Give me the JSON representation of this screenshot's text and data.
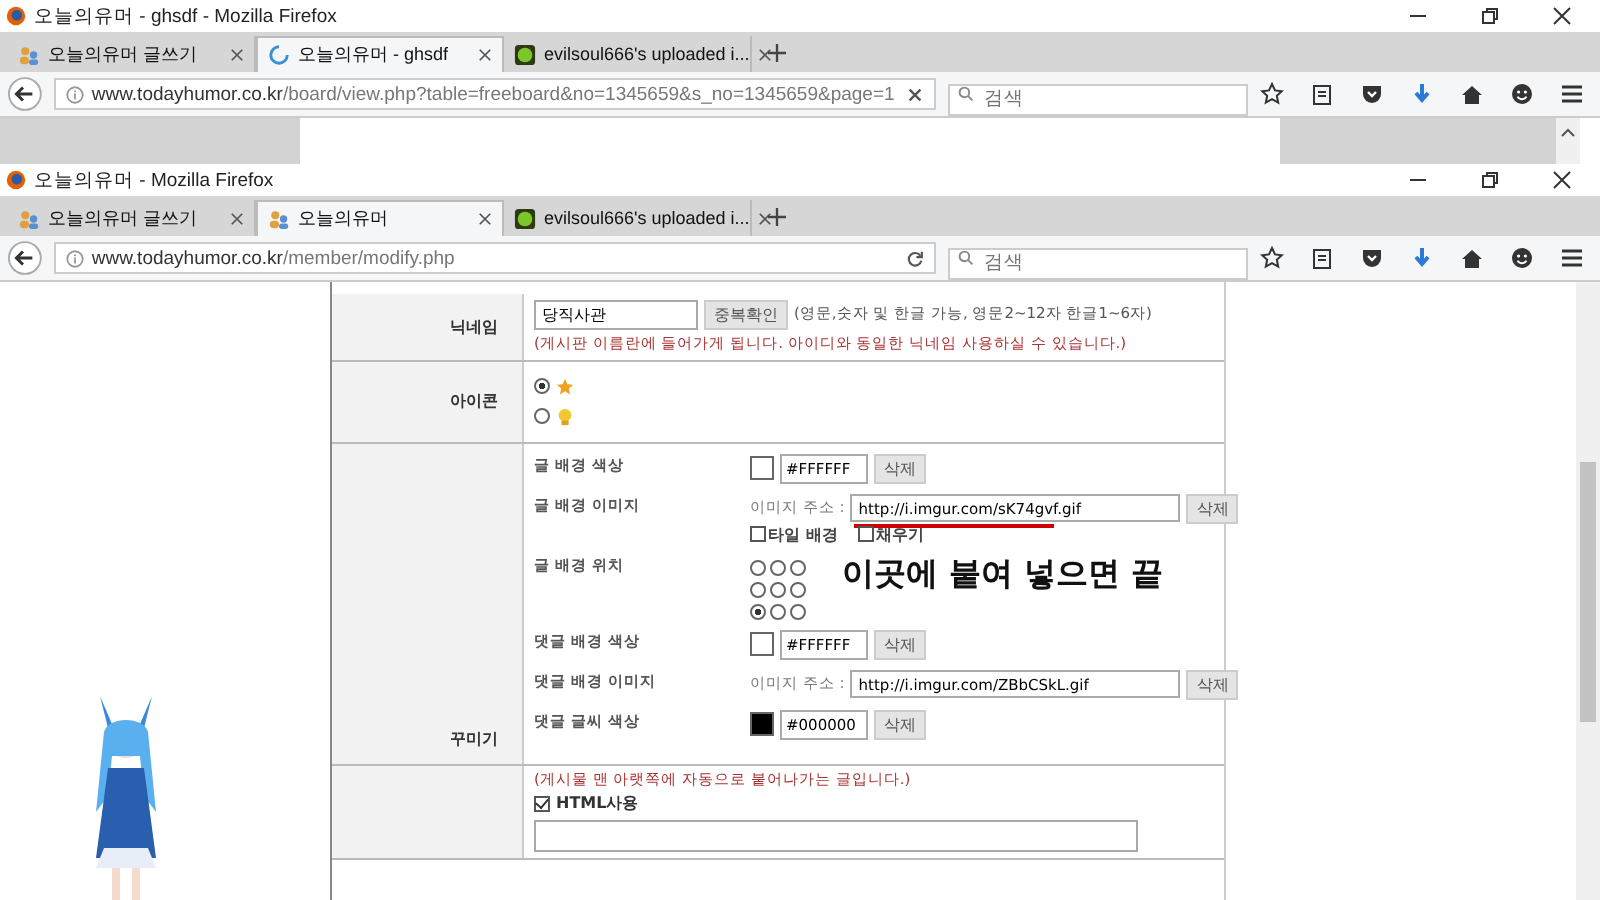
{
  "windows": [
    {
      "title": "오늘의유머 - ghsdf - Mozilla Firefox",
      "loading": true,
      "tabs": [
        {
          "label": "오늘의유머 글쓰기",
          "selected": false,
          "loading": false,
          "kind": "site"
        },
        {
          "label": "오늘의유머 - ghsdf",
          "selected": true,
          "loading": true
        },
        {
          "label": "evilsoul666's uploaded i...",
          "selected": false,
          "loading": false,
          "kind": "game"
        }
      ],
      "url_host": "www.todayhumor.co.kr",
      "url_path": "/board/view.php?table=freeboard&no=1345659&s_no=1345659&page=1",
      "search_placeholder": "검색"
    },
    {
      "title": "오늘의유머 - Mozilla Firefox",
      "loading": false,
      "tabs": [
        {
          "label": "오늘의유머 글쓰기",
          "selected": false,
          "loading": false,
          "kind": "site"
        },
        {
          "label": "오늘의유머",
          "selected": true,
          "loading": false,
          "kind": "site"
        },
        {
          "label": "evilsoul666's uploaded i...",
          "selected": false,
          "loading": false,
          "kind": "game"
        }
      ],
      "url_host": "www.todayhumor.co.kr",
      "url_path": "/member/modify.php",
      "search_placeholder": "검색"
    }
  ],
  "form": {
    "nickname": {
      "label": "닉네임",
      "value": "당직사관",
      "button": "중복확인",
      "hint": "(영문,숫자 및 한글 가능, 영문2~12자 한글1~6자)",
      "note": "(게시판 이름란에 들어가게 됩니다. 아이디와 동일한 닉네임 사용하실 수 있습니다.)"
    },
    "icon": {
      "label": "아이콘",
      "options": [
        {
          "kind": "star",
          "selected": true
        },
        {
          "kind": "medal",
          "selected": false
        }
      ]
    },
    "decorate": {
      "label": "꾸미기",
      "rows": [
        {
          "kind": "color",
          "label": "글 배경 색상",
          "value": "#FFFFFF",
          "button": "삭제"
        },
        {
          "kind": "image",
          "label": "글 배경 이미지",
          "prefix": "이미지 주소 :",
          "value": "http://i.imgur.com/sK74gvf.gif",
          "button": "삭제",
          "underlined": true,
          "options": [
            {
              "label": "타일 배경",
              "checked": false
            },
            {
              "label": "채우기",
              "checked": false
            }
          ]
        },
        {
          "kind": "position",
          "label": "글 배경 위치",
          "positions": [
            {
              "selected": false
            },
            {
              "selected": false
            },
            {
              "selected": false
            },
            {
              "selected": false
            },
            {
              "selected": false
            },
            {
              "selected": false
            },
            {
              "selected": true
            },
            {
              "selected": false
            },
            {
              "selected": false
            }
          ],
          "annotation": "이곳에 붙여 넣으면 끝"
        },
        {
          "kind": "color",
          "label": "댓글 배경 색상",
          "value": "#FFFFFF",
          "button": "삭제"
        },
        {
          "kind": "image",
          "label": "댓글 배경 이미지",
          "prefix": "이미지 주소 :",
          "value": "http://i.imgur.com/ZBbCSkL.gif",
          "button": "삭제",
          "options": []
        },
        {
          "kind": "color",
          "label": "댓글 글씨 색상",
          "value": "#000000",
          "button": "삭제"
        }
      ]
    },
    "signature": {
      "note": "(게시물 맨 아랫쪽에 자동으로 붙어나가는 글입니다.)",
      "html_label": "HTML사용",
      "html_checked": true
    }
  }
}
